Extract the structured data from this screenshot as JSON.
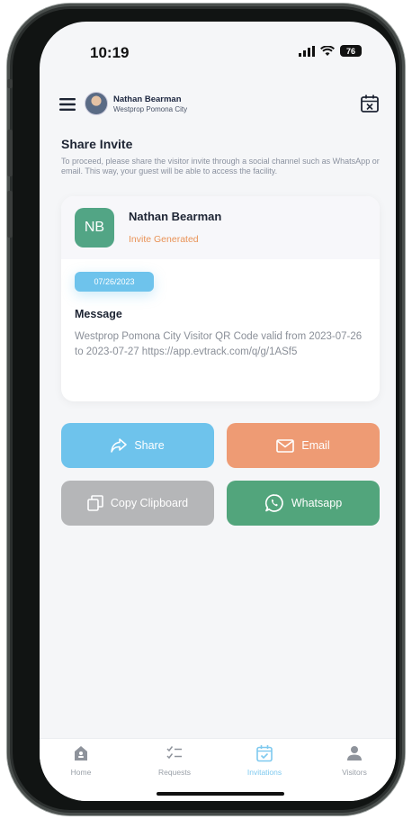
{
  "status_bar": {
    "time": "10:19",
    "battery": "76"
  },
  "header": {
    "user_name": "Nathan Bearman",
    "user_org": "Westprop Pomona City"
  },
  "page": {
    "title": "Share Invite",
    "description": "To proceed, please share the visitor invite through a social channel such as WhatsApp or email. This way, your guest will be able to access the facility."
  },
  "invite_card": {
    "initials": "NB",
    "guest_name": "Nathan Bearman",
    "status": "Invite Generated",
    "date": "07/26/2023",
    "message_label": "Message",
    "message_text": "Westprop Pomona City Visitor QR Code valid from 2023-07-26 to 2023-07-27 https://app.evtrack.com/q/g/1ASf5"
  },
  "actions": {
    "share": "Share",
    "email": "Email",
    "copy": "Copy Clipboard",
    "whatsapp": "Whatsapp"
  },
  "bottom_nav": {
    "items": [
      {
        "label": "Home",
        "icon": "home-icon"
      },
      {
        "label": "Requests",
        "icon": "checklist-icon"
      },
      {
        "label": "Invitations",
        "icon": "calendar-check-icon",
        "active": true
      },
      {
        "label": "Visitors",
        "icon": "person-icon"
      }
    ]
  },
  "colors": {
    "share": "#6ec3ec",
    "email": "#ee9b74",
    "copy": "#b5b6b8",
    "whatsapp": "#52a57c",
    "status_text": "#e99256",
    "active_nav": "#7ec9ef"
  }
}
